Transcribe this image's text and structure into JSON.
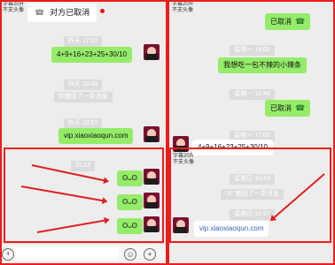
{
  "left": {
    "top_status": {
      "line1": "字幕20开",
      "line2": "不支头像"
    },
    "call_bubble": {
      "text": "对方已取消"
    },
    "stamp1": "昨天 17:07",
    "calc_message": "4+9+16+23+25+30/10",
    "stamp2": "昨天 10:43",
    "recall_notice": "你撤回了一条消息",
    "stamp3": "昨天 10:57",
    "link_message": "vip.xiaoxiaoqun.com",
    "stamp4": "21:52",
    "emoji_messages": [
      "ʘᴗʘ",
      "ʘᴗʘ",
      "ʘᴗʘ"
    ],
    "voice_icon": "voice-icon",
    "emoji_icon": "smiley-icon",
    "plus_icon": "plus-icon"
  },
  "right": {
    "top_status": {
      "line1": "字幕20开",
      "line2": "不支头像"
    },
    "cancelled_bubble_1": "已取消",
    "stamp1": "星期一 13:02",
    "spicy_message": "我想吃一包不辣的小辣条",
    "stamp2": "星期一 12:48",
    "cancelled_bubble_2": "已取消",
    "stamp3": "星期一 17:03",
    "calc_message": "4+9+16+23+25+30/10",
    "stamp4": "星期日 10:43",
    "recall_notice": "\"A\" 撤回了一条消息",
    "stamp5": "星期日 10:57",
    "link_message": "vip.xiaoxiaoqun.com",
    "mid_status": {
      "line1": "字幕20开",
      "line2": "不支头像"
    }
  },
  "colors": {
    "annotation": "#ee1c1c",
    "bubble_green": "#95ec69",
    "chat_bg": "#ededed"
  }
}
